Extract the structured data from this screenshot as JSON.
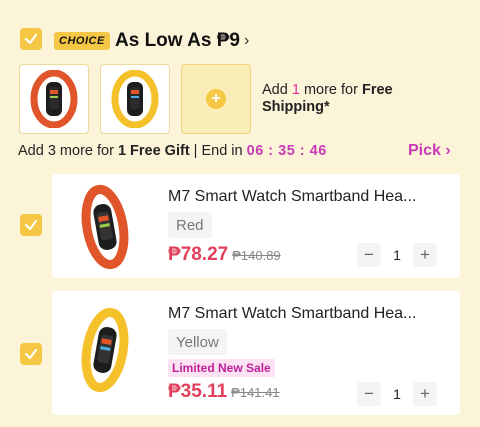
{
  "header": {
    "badge": "CHOICE",
    "title": "As Low As ₱9",
    "chevron": "›"
  },
  "shipping": {
    "prefix": "Add ",
    "count": "1",
    "middle": " more for ",
    "bold": "Free Shipping*"
  },
  "gift": {
    "prefix": "Add 3 more for ",
    "bold": "1 Free Gift",
    "sep": " | End in ",
    "timer": "06 : 35 : 46"
  },
  "pick": {
    "label": "Pick ›"
  },
  "products": [
    {
      "title": "M7 Smart Watch Smartband Hea...",
      "variant": "Red",
      "price": "₱78.27",
      "old_price": "₱140.89",
      "qty": "1",
      "band_color": "#e0552a"
    },
    {
      "title": "M7 Smart Watch Smartband Hea...",
      "variant": "Yellow",
      "tag": "Limited New Sale",
      "price": "₱35.11",
      "old_price": "₱141.41",
      "qty": "1",
      "band_color": "#f5c12b"
    }
  ],
  "stepper": {
    "minus": "−",
    "plus": "+"
  }
}
